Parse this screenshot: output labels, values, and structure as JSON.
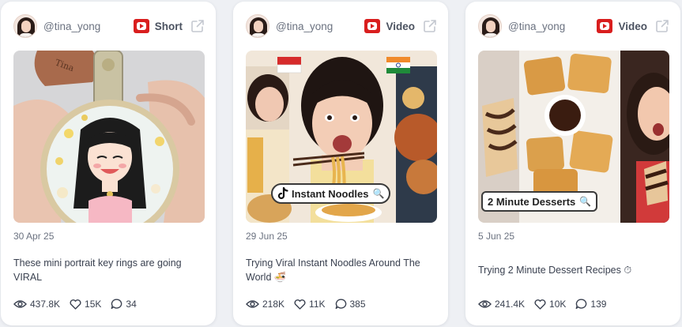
{
  "cards": [
    {
      "handle": "@tina_yong",
      "type_label": "Short",
      "date": "30 Apr 25",
      "title": "These mini portrait key rings are going VIRAL",
      "views": "437.8K",
      "likes": "15K",
      "comments": "34",
      "thumb_text": "",
      "keychain_brand": "Tina"
    },
    {
      "handle": "@tina_yong",
      "type_label": "Video",
      "date": "29 Jun 25",
      "title": "Trying Viral Instant Noodles Around The World 🍜",
      "views": "218K",
      "likes": "11K",
      "comments": "385",
      "thumb_text": "Instant Noodles"
    },
    {
      "handle": "@tina_yong",
      "type_label": "Video",
      "date": "5 Jun 25",
      "title": "Trying 2 Minute Dessert Recipes ⏱",
      "views": "241.4K",
      "likes": "10K",
      "comments": "139",
      "thumb_text": "2 Minute Desserts"
    }
  ],
  "colors": {
    "page_bg": "#eef0f4",
    "card_bg": "#ffffff",
    "youtube_red": "#d91e1e",
    "text": "#3a4150",
    "muted": "#6b7280"
  },
  "icons": {
    "platform": "youtube-icon",
    "external": "external-link-icon",
    "views": "eye-icon",
    "likes": "heart-icon",
    "comments": "comment-icon"
  }
}
